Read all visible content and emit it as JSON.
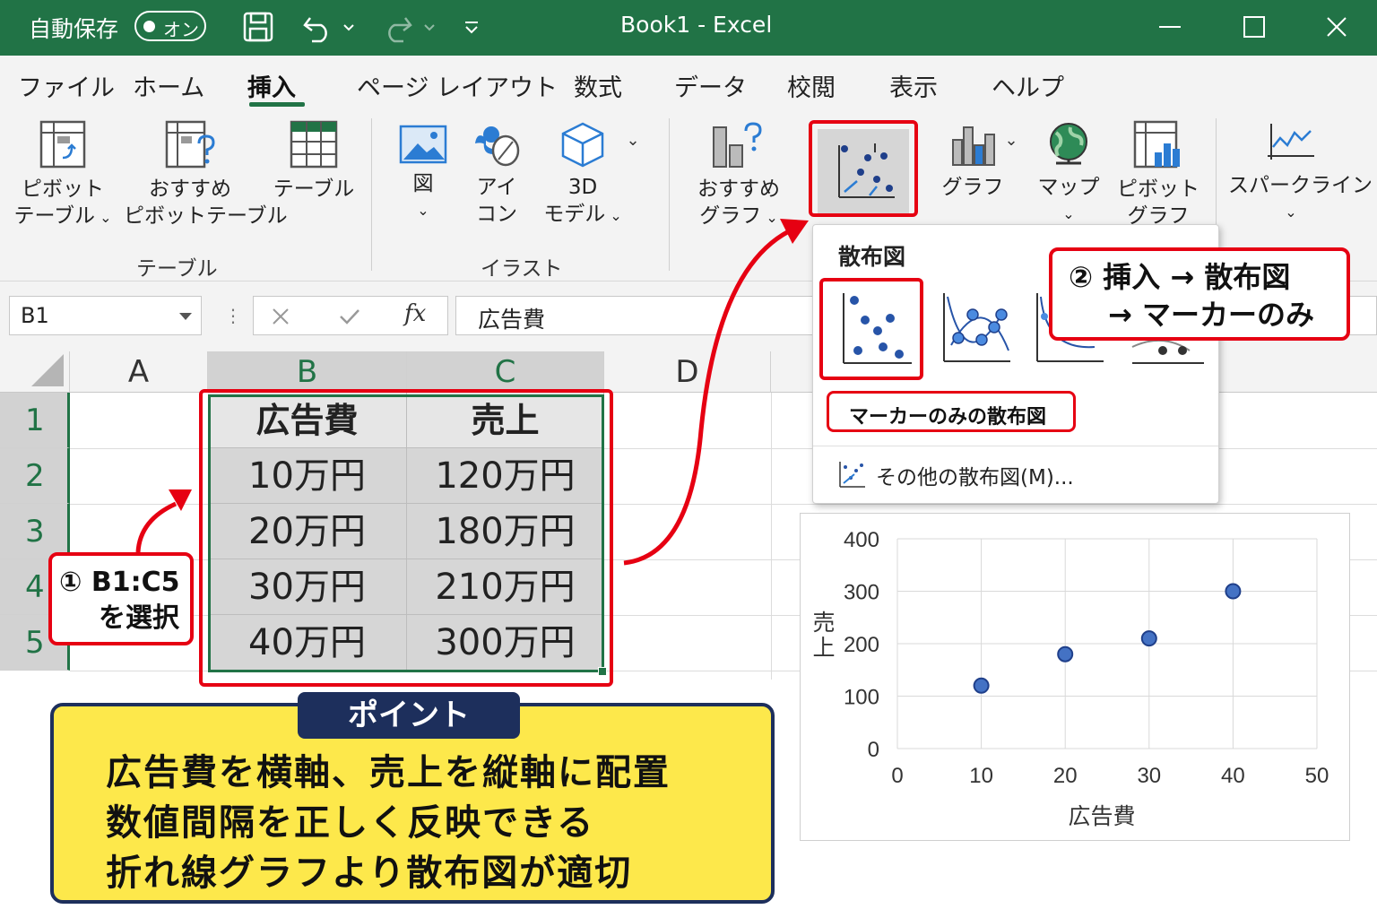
{
  "titlebar": {
    "autosave_label": "自動保存",
    "autosave_state": "オン",
    "window_title": "Book1  -  Excel"
  },
  "menu": {
    "tabs": [
      "ファイル",
      "ホーム",
      "挿入",
      "ページ レイアウト",
      "数式",
      "データ",
      "校閲",
      "表示",
      "ヘルプ"
    ],
    "active_tab": "挿入"
  },
  "ribbon": {
    "pivot_table": [
      "ピボット",
      "テーブル"
    ],
    "recommended_pivot": [
      "おすすめ",
      "ピボットテーブル"
    ],
    "table": "テーブル",
    "group_table": "テーブル",
    "picture": "図",
    "icons": [
      "アイ",
      "コン"
    ],
    "model3d": [
      "3D",
      "モデル"
    ],
    "group_illust": "イラスト",
    "recommended_chart": [
      "おすすめ",
      "グラフ"
    ],
    "chart": "グラフ",
    "map": [
      "マップ"
    ],
    "pivot_chart": [
      "ピボット",
      "グラフ"
    ],
    "sparkline": "スパークライン"
  },
  "formula_bar": {
    "name_box": "B1",
    "fx": "fx",
    "formula": "広告費"
  },
  "grid": {
    "columns": [
      "A",
      "B",
      "C",
      "D"
    ],
    "rows": [
      "1",
      "2",
      "3",
      "4",
      "5"
    ],
    "headers": [
      "広告費",
      "売上"
    ],
    "data": [
      [
        "10万円",
        "120万円"
      ],
      [
        "20万円",
        "180万円"
      ],
      [
        "30万円",
        "210万円"
      ],
      [
        "40万円",
        "300万円"
      ]
    ]
  },
  "dropdown": {
    "section_title": "散布図",
    "highlighted_label": "マーカーのみの散布図",
    "more_link": "その他の散布図(M)..."
  },
  "callouts": {
    "step1_line1": "① B1:C5",
    "step1_line2": "を選択",
    "step2_line1": "② 挿入 → 散布図",
    "step2_line2": "→ マーカーのみ"
  },
  "point": {
    "tab": "ポイント",
    "lines": [
      "広告費を横軸、売上を縦軸に配置",
      "数値間隔を正しく反映できる",
      "折れ線グラフより散布図が適切"
    ]
  },
  "colors": {
    "excel_green": "#217346",
    "highlight_red": "#e60012",
    "point_yellow": "#fde84b",
    "point_navy": "#1d2f5c",
    "marker_blue": "#4472c4"
  },
  "chart_data": {
    "type": "scatter",
    "x": [
      10,
      20,
      30,
      40
    ],
    "y": [
      120,
      180,
      210,
      300
    ],
    "xlabel": "広告費",
    "ylabel": "売上",
    "xlim": [
      0,
      50
    ],
    "ylim": [
      0,
      400
    ],
    "xticks": [
      "0",
      "10",
      "20",
      "30",
      "40",
      "50"
    ],
    "yticks": [
      "0",
      "100",
      "200",
      "300",
      "400"
    ],
    "grid": true
  }
}
